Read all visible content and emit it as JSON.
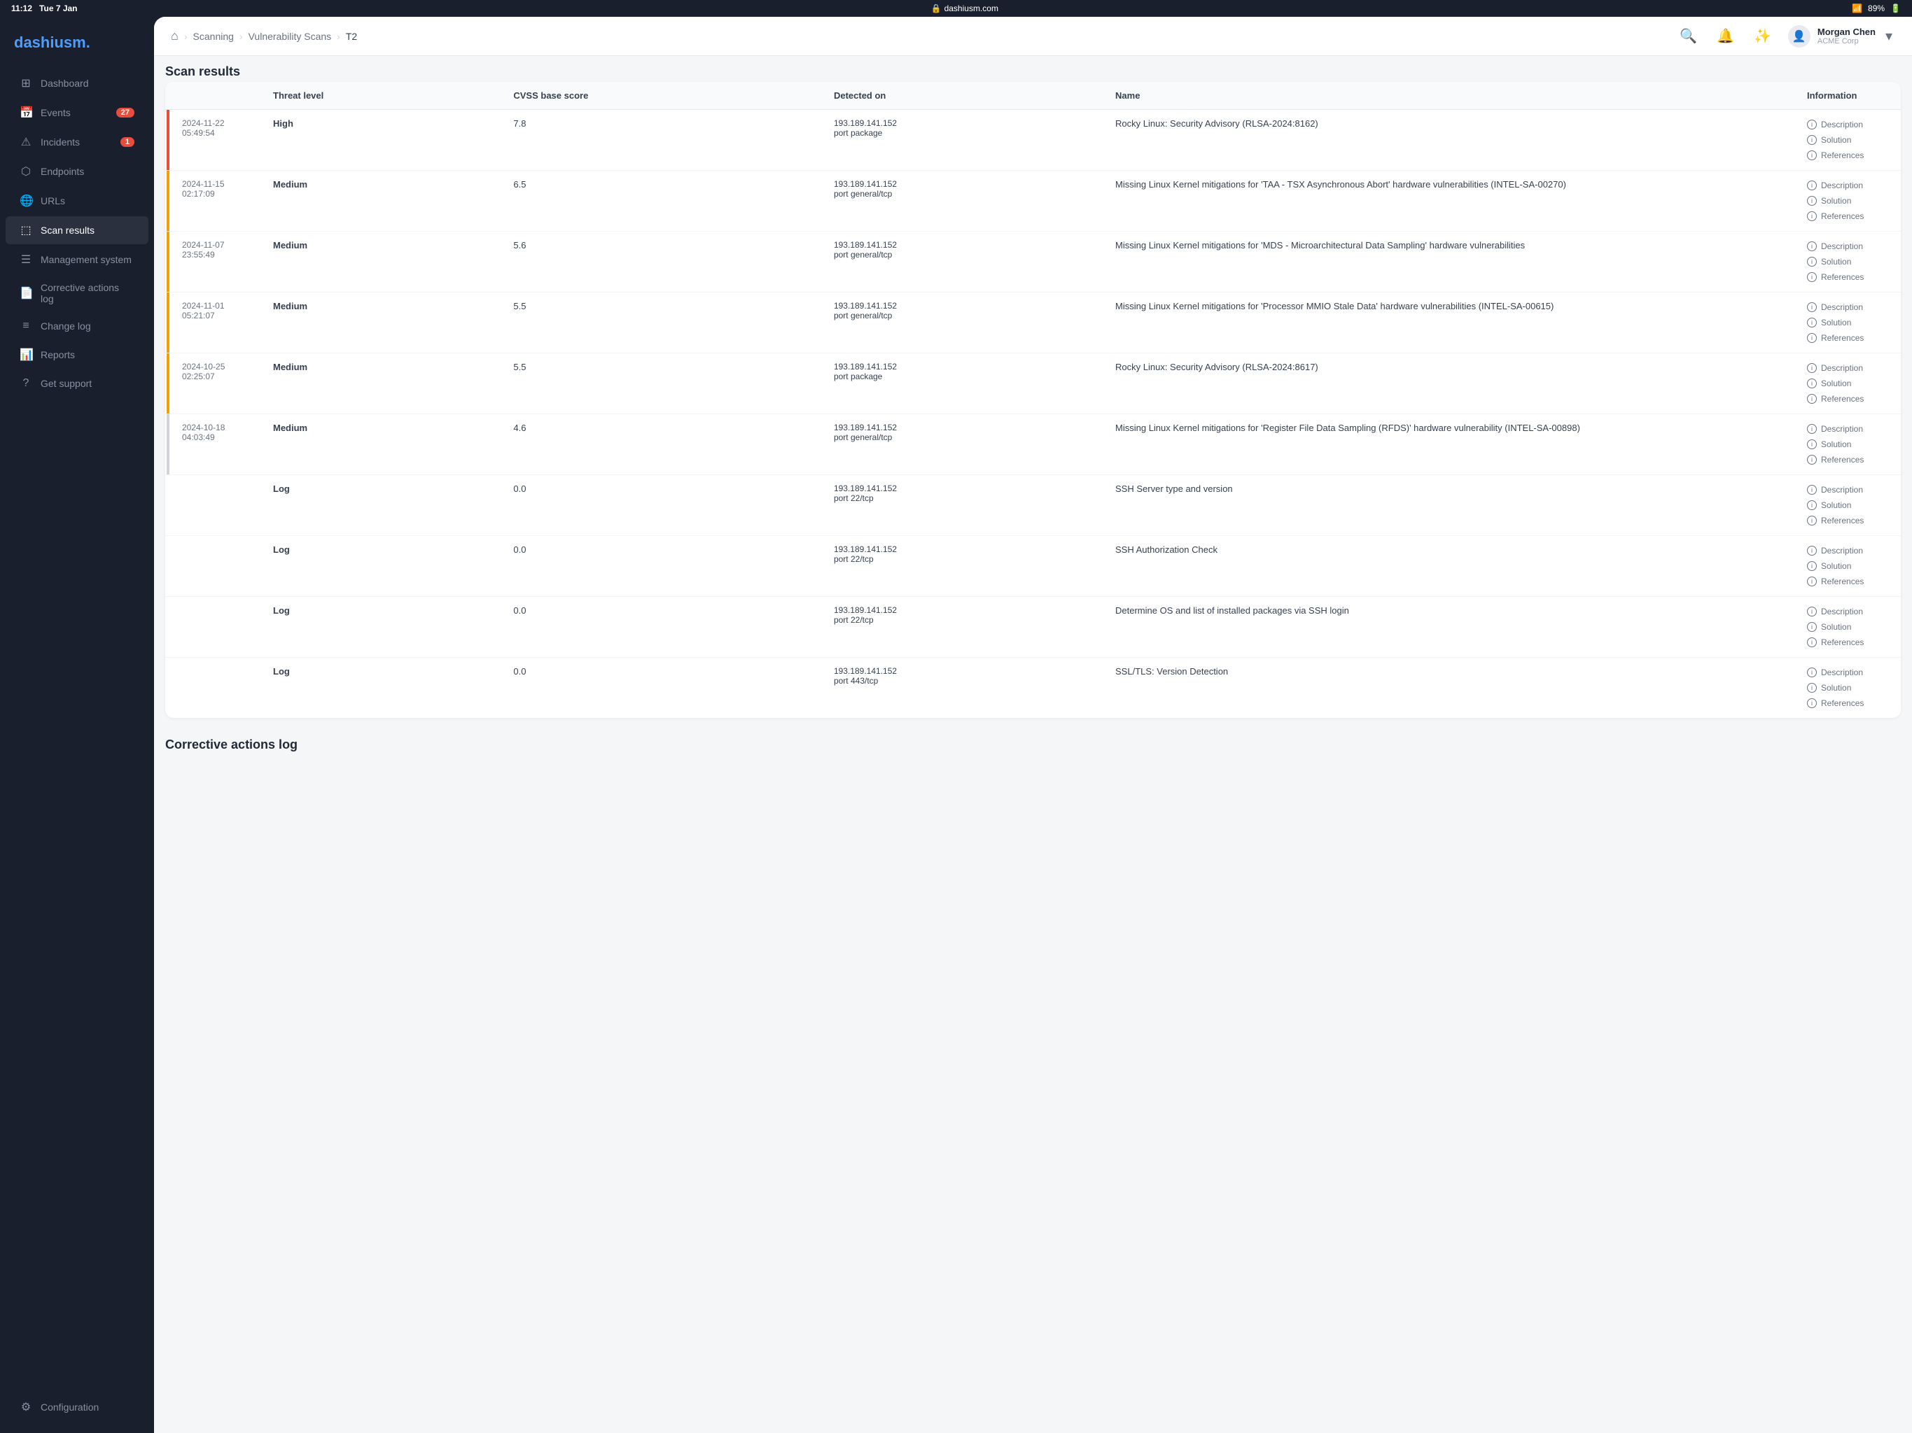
{
  "statusBar": {
    "time": "11:12",
    "day": "Tue 7 Jan",
    "url": "dashiusm.com",
    "battery": "89%"
  },
  "logo": {
    "part1": "dashi",
    "part2": "usm."
  },
  "nav": {
    "items": [
      {
        "id": "dashboard",
        "label": "Dashboard",
        "icon": "⊞",
        "badge": null,
        "active": false
      },
      {
        "id": "events",
        "label": "Events",
        "icon": "📅",
        "badge": "27",
        "active": false
      },
      {
        "id": "incidents",
        "label": "Incidents",
        "icon": "⚠",
        "badge": "1",
        "active": false
      },
      {
        "id": "endpoints",
        "label": "Endpoints",
        "icon": "⬡",
        "badge": null,
        "active": false
      },
      {
        "id": "urls",
        "label": "URLs",
        "icon": "🌐",
        "badge": null,
        "active": false
      },
      {
        "id": "scan-results",
        "label": "Scan results",
        "icon": "⬚",
        "badge": null,
        "active": true
      },
      {
        "id": "management",
        "label": "Management system",
        "icon": "☰",
        "badge": null,
        "active": false
      },
      {
        "id": "corrective",
        "label": "Corrective actions log",
        "icon": "📄",
        "badge": null,
        "active": false
      },
      {
        "id": "change-log",
        "label": "Change log",
        "icon": "≡",
        "badge": null,
        "active": false
      },
      {
        "id": "reports",
        "label": "Reports",
        "icon": "📊",
        "badge": null,
        "active": false
      },
      {
        "id": "support",
        "label": "Get support",
        "icon": "?",
        "badge": null,
        "active": false
      }
    ],
    "bottom": [
      {
        "id": "configuration",
        "label": "Configuration",
        "icon": "⚙",
        "badge": null,
        "active": false
      }
    ]
  },
  "topNav": {
    "homeIcon": "⌂",
    "breadcrumbs": [
      {
        "label": "Scanning",
        "current": false
      },
      {
        "label": "Vulnerability Scans",
        "current": false
      },
      {
        "label": "T2",
        "current": true
      }
    ],
    "user": {
      "name": "Morgan Chen",
      "org": "ACME Corp"
    }
  },
  "sections": {
    "scanResults": "Scan results",
    "correctiveLog": "Corrective actions log"
  },
  "table": {
    "columns": [
      "Threat level",
      "CVSS base score",
      "Detected on",
      "Name",
      "Information"
    ],
    "rows": [
      {
        "timestamp": "2024-11-22\n05:49:54",
        "barColor": "red",
        "threatLevel": "High",
        "threatClass": "threat-high",
        "cvss": "7.8",
        "detectedOn": "193.189.141.152\nport package",
        "name": "Rocky Linux: Security Advisory (RLSA-2024:8162)",
        "info": [
          "Description",
          "Solution",
          "References"
        ]
      },
      {
        "timestamp": "2024-11-15\n02:17:09",
        "barColor": "orange",
        "threatLevel": "Medium",
        "threatClass": "threat-medium",
        "cvss": "6.5",
        "detectedOn": "193.189.141.152\nport general/tcp",
        "name": "Missing Linux Kernel mitigations for 'TAA - TSX Asynchronous Abort' hardware vulnerabilities (INTEL-SA-00270)",
        "info": [
          "Description",
          "Solution",
          "References"
        ]
      },
      {
        "timestamp": "2024-11-07\n23:55:49",
        "barColor": "orange",
        "threatLevel": "Medium",
        "threatClass": "threat-medium",
        "cvss": "5.6",
        "detectedOn": "193.189.141.152\nport general/tcp",
        "name": "Missing Linux Kernel mitigations for 'MDS - Microarchitectural Data Sampling' hardware vulnerabilities",
        "info": [
          "Description",
          "Solution",
          "References"
        ]
      },
      {
        "timestamp": "2024-11-01\n05:21:07",
        "barColor": "orange",
        "threatLevel": "Medium",
        "threatClass": "threat-medium",
        "cvss": "5.5",
        "detectedOn": "193.189.141.152\nport general/tcp",
        "name": "Missing Linux Kernel mitigations for 'Processor MMIO Stale Data' hardware vulnerabilities (INTEL-SA-00615)",
        "info": [
          "Description",
          "Solution",
          "References"
        ]
      },
      {
        "timestamp": "2024-10-25\n02:25:07",
        "barColor": "orange",
        "threatLevel": "Medium",
        "threatClass": "threat-medium",
        "cvss": "5.5",
        "detectedOn": "193.189.141.152\nport package",
        "name": "Rocky Linux: Security Advisory (RLSA-2024:8617)",
        "info": [
          "Description",
          "Solution",
          "References"
        ]
      },
      {
        "timestamp": "2024-10-18\n04:03:49",
        "barColor": "gray",
        "threatLevel": "Medium",
        "threatClass": "threat-medium",
        "cvss": "4.6",
        "detectedOn": "193.189.141.152\nport general/tcp",
        "name": "Missing Linux Kernel mitigations for 'Register File Data Sampling (RFDS)' hardware vulnerability (INTEL-SA-00898)",
        "info": [
          "Description",
          "Solution",
          "References"
        ]
      },
      {
        "timestamp": "",
        "barColor": "none",
        "threatLevel": "Log",
        "threatClass": "threat-log",
        "cvss": "0.0",
        "detectedOn": "193.189.141.152\nport 22/tcp",
        "name": "SSH Server type and version",
        "info": [
          "Description",
          "Solution",
          "References"
        ]
      },
      {
        "timestamp": "",
        "barColor": "none",
        "threatLevel": "Log",
        "threatClass": "threat-log",
        "cvss": "0.0",
        "detectedOn": "193.189.141.152\nport 22/tcp",
        "name": "SSH Authorization Check",
        "info": [
          "Description",
          "Solution",
          "References"
        ]
      },
      {
        "timestamp": "",
        "barColor": "none",
        "threatLevel": "Log",
        "threatClass": "threat-log",
        "cvss": "0.0",
        "detectedOn": "193.189.141.152\nport 22/tcp",
        "name": "Determine OS and list of installed packages via SSH login",
        "info": [
          "Description",
          "Solution",
          "References"
        ]
      },
      {
        "timestamp": "",
        "barColor": "none",
        "threatLevel": "Log",
        "threatClass": "threat-log",
        "cvss": "0.0",
        "detectedOn": "193.189.141.152\nport 443/tcp",
        "name": "SSL/TLS: Version Detection",
        "info": [
          "Description",
          "Solution",
          "References"
        ]
      }
    ]
  }
}
